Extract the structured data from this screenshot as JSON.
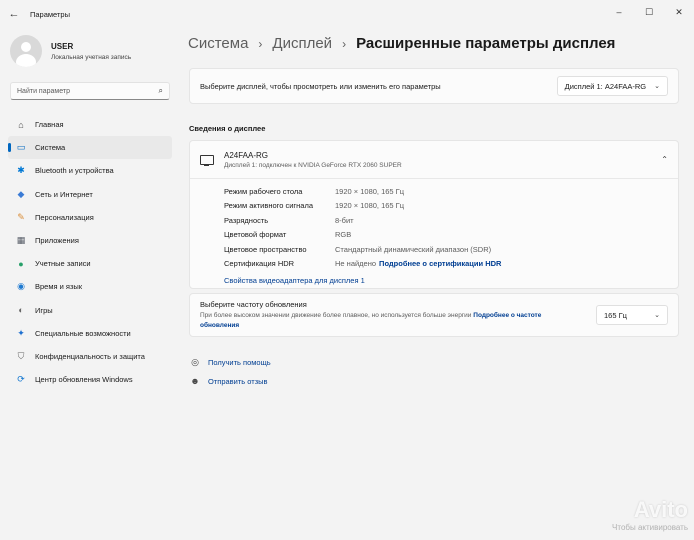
{
  "window": {
    "title": "Параметры",
    "back_glyph": "←",
    "minimize_glyph": "–",
    "maximize_glyph": "☐",
    "close_glyph": "✕"
  },
  "profile": {
    "name": "USER",
    "subtitle": "Локальная учетная запись"
  },
  "search": {
    "placeholder": "Найти параметр",
    "icon": "search-icon",
    "glyph": "⌕"
  },
  "sidebar": {
    "items": [
      {
        "label": "Главная",
        "icon": "home-icon",
        "glyph": "⌂",
        "color": "#444444"
      },
      {
        "label": "Система",
        "icon": "system-icon",
        "glyph": "▭",
        "color": "#0067c0"
      },
      {
        "label": "Bluetooth и устройства",
        "icon": "bluetooth-icon",
        "glyph": "✱",
        "color": "#0078d4"
      },
      {
        "label": "Сеть и Интернет",
        "icon": "wifi-icon",
        "glyph": "◆",
        "color": "#3a7bd5"
      },
      {
        "label": "Персонализация",
        "icon": "brush-icon",
        "glyph": "✎",
        "color": "#d98c36"
      },
      {
        "label": "Приложения",
        "icon": "apps-icon",
        "glyph": "▦",
        "color": "#555b66"
      },
      {
        "label": "Учетные записи",
        "icon": "accounts-icon",
        "glyph": "●",
        "color": "#28a06a"
      },
      {
        "label": "Время и язык",
        "icon": "globe-icon",
        "glyph": "◉",
        "color": "#1f7ad1"
      },
      {
        "label": "Игры",
        "icon": "gamepad-icon",
        "glyph": "◐",
        "color": "#666666"
      },
      {
        "label": "Специальные возможности",
        "icon": "accessibility-icon",
        "glyph": "✦",
        "color": "#1c6fd0"
      },
      {
        "label": "Конфиденциальность и защита",
        "icon": "shield-icon",
        "glyph": "⛉",
        "color": "#666666"
      },
      {
        "label": "Центр обновления Windows",
        "icon": "update-icon",
        "glyph": "⟳",
        "color": "#0e74cf"
      }
    ],
    "active_index": 1
  },
  "breadcrumb": {
    "level1": "Система",
    "level2": "Дисплей",
    "current": "Расширенные параметры дисплея",
    "separator": "›"
  },
  "display_select": {
    "label": "Выберите дисплей, чтобы просмотреть или изменить его параметры",
    "value": "Дисплей 1: A24FAA-RG",
    "chevron": "⌄"
  },
  "info_section": {
    "title": "Сведения о дисплее",
    "monitor_name": "A24FAA-RG",
    "monitor_desc": "Дисплей 1: подключен к NVIDIA GeForce RTX 2060 SUPER",
    "collapse_glyph": "⌃",
    "rows": [
      {
        "key": "Режим рабочего стола",
        "value": "1920 × 1080, 165 Гц"
      },
      {
        "key": "Режим активного сигнала",
        "value": "1920 × 1080, 165 Гц"
      },
      {
        "key": "Разрядность",
        "value": "8-бит"
      },
      {
        "key": "Цветовой формат",
        "value": "RGB"
      },
      {
        "key": "Цветовое пространство",
        "value": "Стандартный динамический диапазон (SDR)"
      },
      {
        "key": "Сертификация HDR",
        "value": "Не найдено",
        "link": "Подробнее о сертификации HDR"
      }
    ],
    "adapter_link": "Свойства видеоадаптера для дисплея 1"
  },
  "refresh": {
    "title": "Выберите частоту обновления",
    "desc": "При более высоком значении движение более плавное, но используется больше энергии",
    "link": "Подробнее о частоте обновления",
    "value": "165 Гц",
    "chevron": "⌄"
  },
  "help": {
    "get_help": "Получить помощь",
    "feedback": "Отправить отзыв"
  },
  "watermark": {
    "brand": "Avito",
    "activation": "Чтобы активировать"
  }
}
